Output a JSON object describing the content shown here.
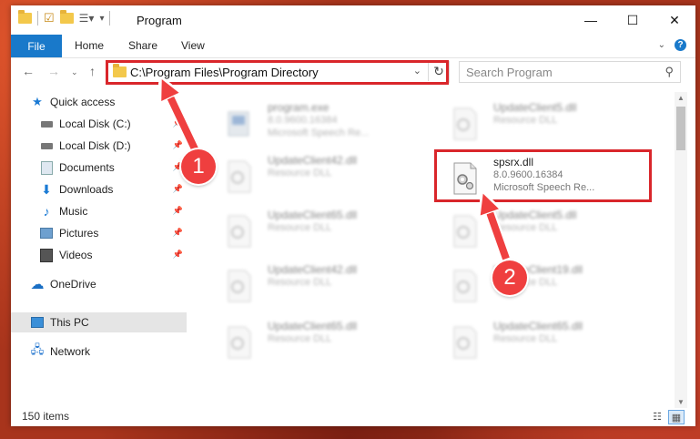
{
  "window": {
    "title": "Program"
  },
  "ribbon": {
    "file": "File",
    "tabs": [
      "Home",
      "Share",
      "View"
    ]
  },
  "address": {
    "path": "C:\\Program Files\\Program Directory",
    "search_placeholder": "Search Program"
  },
  "sidebar": {
    "items": [
      {
        "label": "Quick access",
        "icon": "star-icon"
      },
      {
        "label": "Local Disk (C:)",
        "icon": "drive-icon",
        "pinned": true
      },
      {
        "label": "Local Disk (D:)",
        "icon": "drive-icon",
        "pinned": true
      },
      {
        "label": "Documents",
        "icon": "documents-icon",
        "pinned": true
      },
      {
        "label": "Downloads",
        "icon": "downloads-icon",
        "pinned": true
      },
      {
        "label": "Music",
        "icon": "music-icon",
        "pinned": true
      },
      {
        "label": "Pictures",
        "icon": "pictures-icon",
        "pinned": true
      },
      {
        "label": "Videos",
        "icon": "videos-icon",
        "pinned": true
      },
      {
        "label": "OneDrive",
        "icon": "cloud-icon"
      },
      {
        "label": "This PC",
        "icon": "pc-icon",
        "selected": true
      },
      {
        "label": "Network",
        "icon": "network-icon"
      }
    ]
  },
  "files": [
    {
      "name": "program.exe",
      "version": "8.0.9600.16384",
      "desc": "Microsoft Speech Re...",
      "blurred": true
    },
    {
      "name": "UpdateClient5.dll",
      "version": "",
      "desc": "Resource DLL",
      "blurred": true
    },
    {
      "name": "UpdateClient42.dll",
      "version": "",
      "desc": "Resource DLL",
      "blurred": true
    },
    {
      "name": "spsrx.dll",
      "version": "8.0.9600.16384",
      "desc": "Microsoft Speech Re...",
      "blurred": false
    },
    {
      "name": "UpdateClient65.dll",
      "version": "",
      "desc": "Resource DLL",
      "blurred": true
    },
    {
      "name": "UpdateClient5.dll",
      "version": "",
      "desc": "Resource DLL",
      "blurred": true
    },
    {
      "name": "UpdateClient42.dll",
      "version": "",
      "desc": "Resource DLL",
      "blurred": true
    },
    {
      "name": "UpdateClient19.dll",
      "version": "",
      "desc": "Resource DLL",
      "blurred": true
    },
    {
      "name": "UpdateClient65.dll",
      "version": "",
      "desc": "Resource DLL",
      "blurred": true
    },
    {
      "name": "UpdateClient65.dll",
      "version": "",
      "desc": "Resource DLL",
      "blurred": true
    }
  ],
  "status": {
    "items": "150 items"
  },
  "callouts": [
    "1",
    "2"
  ],
  "colors": {
    "accent": "#1979ca",
    "highlight": "#d9262b",
    "callout": "#ef3f3f"
  }
}
